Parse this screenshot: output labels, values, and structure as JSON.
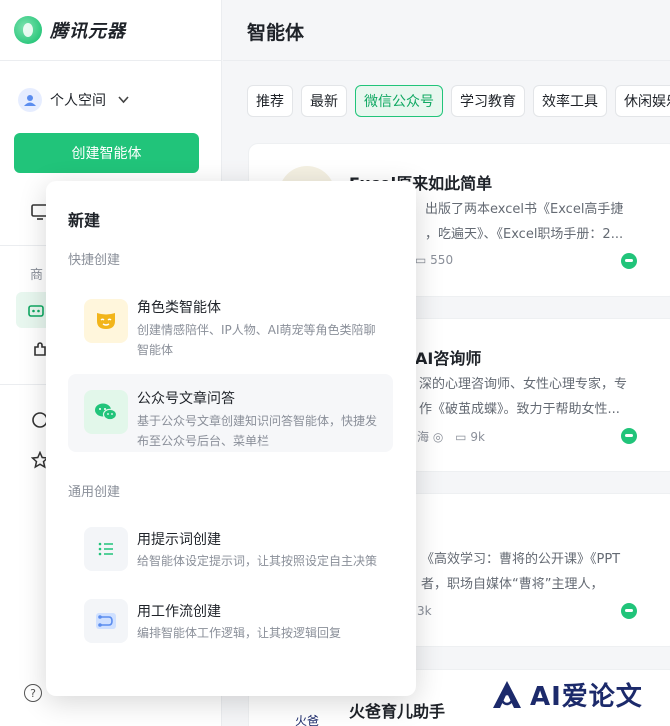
{
  "app": {
    "name": "腾讯元器"
  },
  "sidebar": {
    "space_label": "个人空间",
    "create_label": "创建智能体",
    "section_label": "商"
  },
  "main": {
    "title": "智能体",
    "tabs": [
      {
        "label": "推荐"
      },
      {
        "label": "最新"
      },
      {
        "label": "微信公众号",
        "active": true
      },
      {
        "label": "学习教育"
      },
      {
        "label": "效率工具"
      },
      {
        "label": "休闲娱乐"
      }
    ],
    "cards": [
      {
        "title": "Excel原来如此简单",
        "desc1": "出版了两本excel书《Excel高手捷",
        "desc2": "，吃遍天》、《Excel职场手册：2...",
        "meta": "550"
      },
      {
        "title": "AI咨询师",
        "desc1": "深的心理咨询师、女性心理专家，专",
        "desc2": "作《破茧成蝶》。致力于帮助女性...",
        "meta": "9k",
        "meta_left": "海"
      },
      {
        "title": "",
        "desc1": "《高效学习：曹将的公开课》《PPT",
        "desc2": "者，职场自媒体“曹将”主理人，",
        "meta": "3k"
      },
      {
        "title": "火爸育儿助手",
        "thumb_text": "火爸"
      }
    ]
  },
  "popup": {
    "title": "新建",
    "quick_label": "快捷创建",
    "general_label": "通用创建",
    "options": [
      {
        "title": "角色类智能体",
        "desc": "创建情感陪伴、IP人物、AI萌宠等角色类陪聊智能体"
      },
      {
        "title": "公众号文章问答",
        "desc": "基于公众号文章创建知识问答智能体，快捷发布至公众号后台、菜单栏"
      },
      {
        "title": "用提示词创建",
        "desc": "给智能体设定提示词，让其按照设定自主决策"
      },
      {
        "title": "用工作流创建",
        "desc": "编排智能体工作逻辑，让其按逻辑回复"
      }
    ]
  },
  "watermark": {
    "text": "AI爱论文"
  },
  "colors": {
    "accent": "#21c47a",
    "accent_light": "#e8f7ef",
    "text": "#1f2329",
    "muted": "#8a8f99"
  }
}
